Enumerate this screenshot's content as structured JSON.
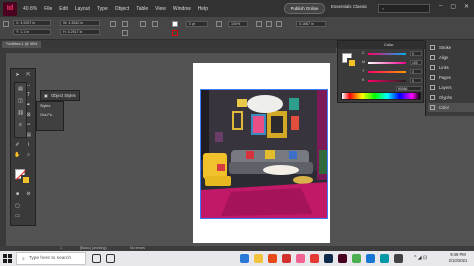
{
  "app": {
    "logo": "Id",
    "zoom": "40.8%"
  },
  "menu": [
    "File",
    "Edit",
    "Layout",
    "Type",
    "Object",
    "Table",
    "View",
    "Window",
    "Help"
  ],
  "header": {
    "publish": "Publish Online",
    "workspace": "Essentials Classic"
  },
  "controlbar": {
    "x": "X: 4.9267 in",
    "y": "Y: 1.1 in",
    "w": "W: 4.3542 in",
    "h": "H: 4.2917 in",
    "stroke": "0 pt",
    "pct": "100%",
    "offset": "0.1667 in"
  },
  "document": {
    "tab": "*Untitled-1 @ 40%"
  },
  "panels": {
    "object_styles": "Object Styles",
    "styles_items": [
      "Styles",
      "Gra.Fe.."
    ],
    "color_title": "Color"
  },
  "color": {
    "rows": [
      {
        "label": "C",
        "value": "0"
      },
      {
        "label": "M",
        "value": "100"
      },
      {
        "label": "Y",
        "value": "0"
      },
      {
        "label": "K",
        "value": "0"
      }
    ],
    "hex": "ff0066"
  },
  "right_panel": [
    "Stroke",
    "Align",
    "Links",
    "Pages",
    "Layers",
    "Glyphs",
    "Color"
  ],
  "statusbar": {
    "page": "1",
    "style": "[Basic] (working)",
    "errors": "No errors"
  },
  "taskbar": {
    "search_placeholder": "Type here to search",
    "time": "9:49 PM",
    "date": "2/10/2021"
  }
}
